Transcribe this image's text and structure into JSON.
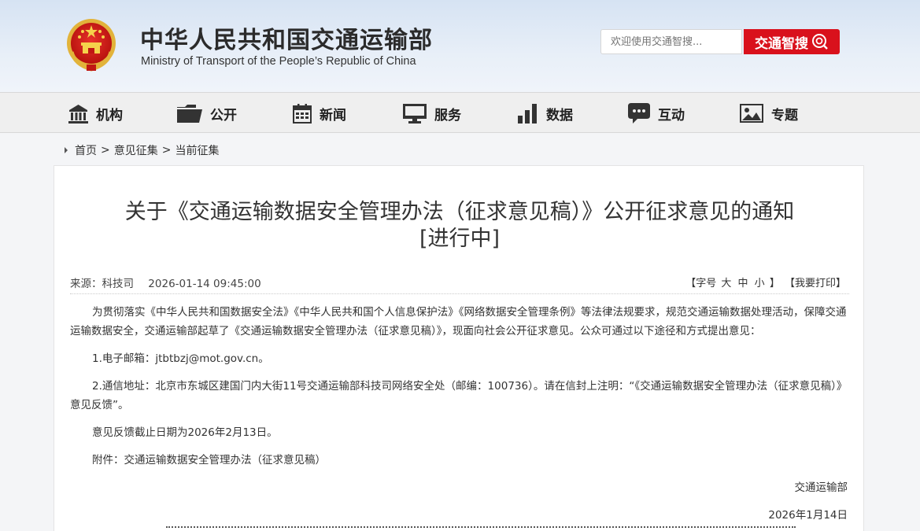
{
  "header": {
    "title": "中华人民共和国交通运输部",
    "subtitle": "Ministry of Transport of the People’s Republic of China",
    "search_placeholder": "欢迎使用交通智搜...",
    "search_button": "交通智搜"
  },
  "nav": {
    "items": [
      {
        "label": "机构",
        "icon": "building-icon"
      },
      {
        "label": "公开",
        "icon": "folder-icon"
      },
      {
        "label": "新闻",
        "icon": "calendar-icon"
      },
      {
        "label": "服务",
        "icon": "monitor-icon"
      },
      {
        "label": "数据",
        "icon": "bar-chart-icon"
      },
      {
        "label": "互动",
        "icon": "chat-icon"
      },
      {
        "label": "专题",
        "icon": "picture-icon"
      }
    ]
  },
  "breadcrumb": {
    "home": "首页",
    "section": "意见征集",
    "current": "当前征集",
    "sep": ">"
  },
  "article": {
    "title_line1": "关于《交通运输数据安全管理办法（征求意见稿）》公开征求意见的通知",
    "title_line2": "[进行中]",
    "source": "来源：科技司",
    "date": "2026-01-14 09:45:00",
    "tools": {
      "open_bracket": "【字号",
      "size_large": "大",
      "size_medium": "中",
      "size_small": "小",
      "close_bracket": "】",
      "print": "【我要打印】"
    },
    "paragraphs": {
      "intro": "为贯彻落实《中华人民共和国数据安全法》《中华人民共和国个人信息保护法》《网络数据安全管理条例》等法律法规要求，规范交通运输数据处理活动，保障交通运输数据安全，交通运输部起草了《交通运输数据安全管理办法（征求意见稿）》，现面向社会公开征求意见。公众可通过以下途径和方式提出意见：",
      "email_prefix": "1.电子邮箱：",
      "email": "jtbtbzj@mot.gov.cn",
      "email_suffix": "。",
      "mail": "2.通信地址：北京市东城区建国门内大街11号交通运输部科技司网络安全处（邮编：100736）。请在信封上注明：“《交通运输数据安全管理办法（征求意见稿）》意见反馈”。",
      "deadline": "意见反馈截止日期为2026年2月13日。",
      "attachment_prefix": "附件：",
      "attachment": "交通运输数据安全管理办法（征求意见稿）",
      "signature": "交通运输部",
      "sign_date": "2026年1月14日"
    }
  },
  "colors": {
    "accent_red": "#d9111c",
    "header_bg": "#dce7f5",
    "nav_bg": "#efefef"
  }
}
